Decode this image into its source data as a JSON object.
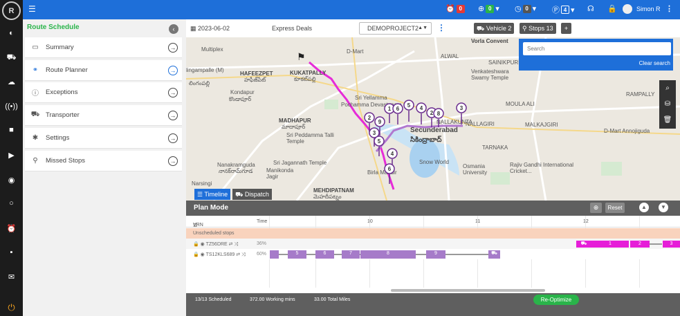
{
  "colors": {
    "topbar": "#1e6fd9",
    "accent": "#2ab44a",
    "route": "#e62bd8",
    "timeline_bar": "#a67bc9",
    "scheduled_bar": "#e61ed8",
    "unscheduled": "#f9d3bd"
  },
  "topbar": {
    "menu_icon": "menu-icon",
    "alert_count": "0",
    "alert_color": "#e53935",
    "status_count": "0",
    "status_color": "#2ab44a",
    "time_count": "0",
    "time_color": "#555",
    "p_count": "4",
    "p_color": "#1e6fd9",
    "user_name": "Simon R"
  },
  "sidebar": {
    "title": "Route Schedule",
    "items": [
      {
        "label": "Summary",
        "icon": "summary-icon"
      },
      {
        "label": "Route Planner",
        "icon": "route-planner-icon"
      },
      {
        "label": "Exceptions",
        "icon": "exceptions-icon"
      },
      {
        "label": "Transporter",
        "icon": "transporter-icon"
      },
      {
        "label": "Settings",
        "icon": "settings-icon"
      },
      {
        "label": "Missed Stops",
        "icon": "missed-stops-icon"
      }
    ]
  },
  "toolbar": {
    "date": "2023-06-02",
    "deal": "Express Deals",
    "project": "DEMOPROJECT2",
    "vehicle_label": "Vehicle 2",
    "stops_label": "Stops 13"
  },
  "search": {
    "placeholder": "Search",
    "clear": "Clear search"
  },
  "map": {
    "labels": [
      "Multiplex",
      "HAFEEZPET",
      "హఫీజ్‌పేట్",
      "lingampalle (M)",
      "లింగంపల్లి",
      "KUKATPALLY",
      "కూకట్‌పల్లి",
      "Kondapur",
      "కొండాపూర్",
      "D-Mart",
      "MADHAPUR",
      "మాదాపూర్",
      "Sri Peddamma Talli Temple",
      "Pochamma Devastanam",
      "Sri Yellamma",
      "Secunderabad",
      "సికింద్రాబాద్",
      "NALLAKUNTA",
      "Snow World",
      "Birla Mandir",
      "Nanakramguda",
      "నానక్‌రామ్‌గూడ",
      "Narsingi",
      "Sri Jagannath Temple",
      "Manikonda Jagir",
      "MEHDIPATNAM",
      "మెహదీపట్నం",
      "Osmania University",
      "Rajiv Gandhi International Cricket...",
      "TARNAKA",
      "MOULA ALI",
      "Venkateshwara Swamy Temple",
      "SAINIKPURI",
      "ALWAL",
      "D-Mart Annojiguda",
      "RAMPALLY",
      "NALLAGIRI",
      "MALKAJGIRI",
      "Vorla Convent"
    ],
    "stop_numbers": [
      "1",
      "2",
      "2",
      "3",
      "3",
      "4",
      "4",
      "5",
      "5",
      "6",
      "6",
      "8",
      "9"
    ]
  },
  "tabs": {
    "timeline": "Timeline",
    "dispatch": "Dispatch"
  },
  "plan": {
    "title": "Plan Mode",
    "reset": "Reset"
  },
  "gantt": {
    "col_vrn": "VRN",
    "col_time": "Time",
    "hours": [
      "10",
      "11",
      "12"
    ],
    "unscheduled": "Unscheduled stops",
    "rows": [
      {
        "vrn": "TZ56DRE",
        "pct": "36%",
        "segments": [
          "1",
          "2",
          "3"
        ]
      },
      {
        "vrn": "TS12KLS689",
        "pct": "60%",
        "segments": [
          "5",
          "6",
          "7",
          "8",
          "9"
        ]
      }
    ]
  },
  "footer": {
    "scheduled": "13/13 Scheduled",
    "working": "372.00 Working mins",
    "miles": "33.00 Total Miles",
    "reoptimize": "Re-Optimize"
  }
}
